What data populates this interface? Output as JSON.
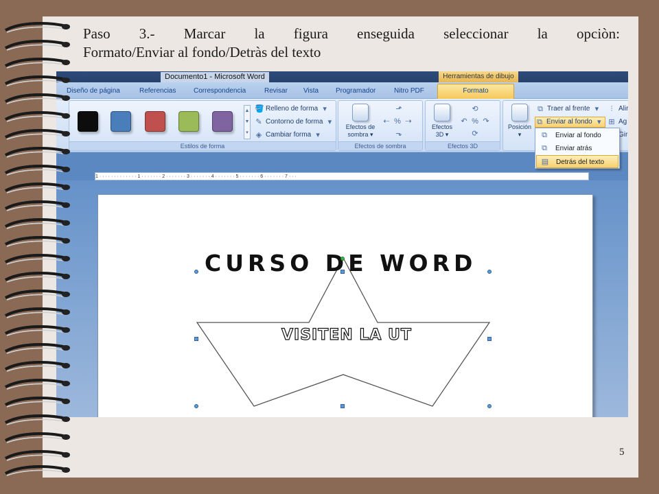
{
  "slide": {
    "heading_line1": "Paso 3.- Marcar la figura enseguida seleccionar la opciòn:",
    "heading_line2": "Formato/Enviar al fondo/Detràs del texto",
    "page_number": "5"
  },
  "word": {
    "window_title": "Documento1 - Microsoft Word",
    "context_title": "Herramientas de dibujo",
    "tabs": [
      "Diseño de página",
      "Referencias",
      "Correspondencia",
      "Revisar",
      "Vista",
      "Programador",
      "Nitro PDF"
    ],
    "active_tab": "Formato",
    "ribbon": {
      "shape_styles": {
        "label": "Estilos de forma",
        "swatch_colors": [
          "#0d0d0d",
          "#4a7ebb",
          "#c0504d",
          "#9bbb59",
          "#8064a2"
        ],
        "fill": "Relleno de forma",
        "outline": "Contorno de forma",
        "change": "Cambiar forma"
      },
      "shadow": {
        "button": "Efectos de sombra",
        "label": "Efectos de sombra"
      },
      "effects3d": {
        "button": "Efectos 3D",
        "label": "Efectos 3D"
      },
      "arrange": {
        "position": "Posición",
        "bring_front": "Traer al frente",
        "send_back": "Enviar al fondo",
        "align_partial": "Alir",
        "group_partial": "Ag",
        "rotate_partial": "Gir"
      }
    },
    "dropdown": [
      "Enviar al fondo",
      "Enviar atrás",
      "Detrás del texto"
    ],
    "document": {
      "wordart": "CURSO DE WORD",
      "star_text": "VISITEN LA UT"
    },
    "ruler_text": "1 · · · · · · · · · · · · · 1 · · · · · · · 2 · · · · · · · 3 · · · · · · · 4 · · · · · · · 5 · · · · · · · 6 · · · · · · · 7 · · ·"
  }
}
